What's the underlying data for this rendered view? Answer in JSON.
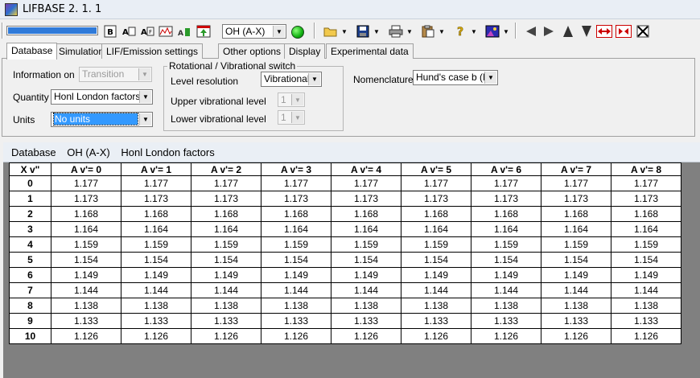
{
  "window": {
    "title": "LIFBASE  2. 1. 1"
  },
  "toolbar": {
    "progress_fraction": 1.0,
    "molecule_combo": "OH (A-X)",
    "icons": [
      "image-b-icon",
      "image-a-icon",
      "image-f-icon",
      "image-spectrum-icon",
      "image-ab-icon",
      "window-arrow-icon",
      "open-folder-icon",
      "save-disk-icon",
      "print-icon",
      "clipboard-icon",
      "help-icon",
      "image-icon",
      "arrow-left-icon",
      "arrow-right-icon",
      "triangle-up-icon",
      "triangle-down-icon",
      "expand-arrows-icon",
      "collapse-arrows-icon",
      "close-box-icon"
    ]
  },
  "tabs": [
    {
      "label": "Database"
    },
    {
      "label": "Simulation"
    },
    {
      "label": "LIF/Emission settings"
    },
    {
      "label": "Other options"
    },
    {
      "label": "Display"
    },
    {
      "label": "Experimental data"
    }
  ],
  "panel": {
    "information_label": "Information on",
    "information_value": "Transition",
    "quantity_label": "Quantity",
    "quantity_value": "Honl London factors",
    "units_label": "Units",
    "units_value": "No units",
    "switch_title": "Rotational / Vibrational switch",
    "level_resolution_label": "Level resolution",
    "level_resolution_value": "Vibrational",
    "upper_label": "Upper vibrational level",
    "upper_value": "1",
    "lower_label": "Lower vibrational level",
    "lower_value": "1",
    "nomenclature_label": "Nomenclature",
    "nomenclature_value": "Hund's case b (N"
  },
  "grid_header": {
    "database": "Database",
    "molecule": "OH (A-X)",
    "quantity": "Honl London factors"
  },
  "table": {
    "columns": [
      "X v\"",
      "A v'= 0",
      "A v'= 1",
      "A v'= 2",
      "A v'= 3",
      "A v'= 4",
      "A v'= 5",
      "A v'= 6",
      "A v'= 7",
      "A v'= 8"
    ],
    "rows": [
      [
        "0",
        "1.177",
        "1.177",
        "1.177",
        "1.177",
        "1.177",
        "1.177",
        "1.177",
        "1.177",
        "1.177"
      ],
      [
        "1",
        "1.173",
        "1.173",
        "1.173",
        "1.173",
        "1.173",
        "1.173",
        "1.173",
        "1.173",
        "1.173"
      ],
      [
        "2",
        "1.168",
        "1.168",
        "1.168",
        "1.168",
        "1.168",
        "1.168",
        "1.168",
        "1.168",
        "1.168"
      ],
      [
        "3",
        "1.164",
        "1.164",
        "1.164",
        "1.164",
        "1.164",
        "1.164",
        "1.164",
        "1.164",
        "1.164"
      ],
      [
        "4",
        "1.159",
        "1.159",
        "1.159",
        "1.159",
        "1.159",
        "1.159",
        "1.159",
        "1.159",
        "1.159"
      ],
      [
        "5",
        "1.154",
        "1.154",
        "1.154",
        "1.154",
        "1.154",
        "1.154",
        "1.154",
        "1.154",
        "1.154"
      ],
      [
        "6",
        "1.149",
        "1.149",
        "1.149",
        "1.149",
        "1.149",
        "1.149",
        "1.149",
        "1.149",
        "1.149"
      ],
      [
        "7",
        "1.144",
        "1.144",
        "1.144",
        "1.144",
        "1.144",
        "1.144",
        "1.144",
        "1.144",
        "1.144"
      ],
      [
        "8",
        "1.138",
        "1.138",
        "1.138",
        "1.138",
        "1.138",
        "1.138",
        "1.138",
        "1.138",
        "1.138"
      ],
      [
        "9",
        "1.133",
        "1.133",
        "1.133",
        "1.133",
        "1.133",
        "1.133",
        "1.133",
        "1.133",
        "1.133"
      ],
      [
        "10",
        "1.126",
        "1.126",
        "1.126",
        "1.126",
        "1.126",
        "1.126",
        "1.126",
        "1.126",
        "1.126"
      ]
    ]
  }
}
